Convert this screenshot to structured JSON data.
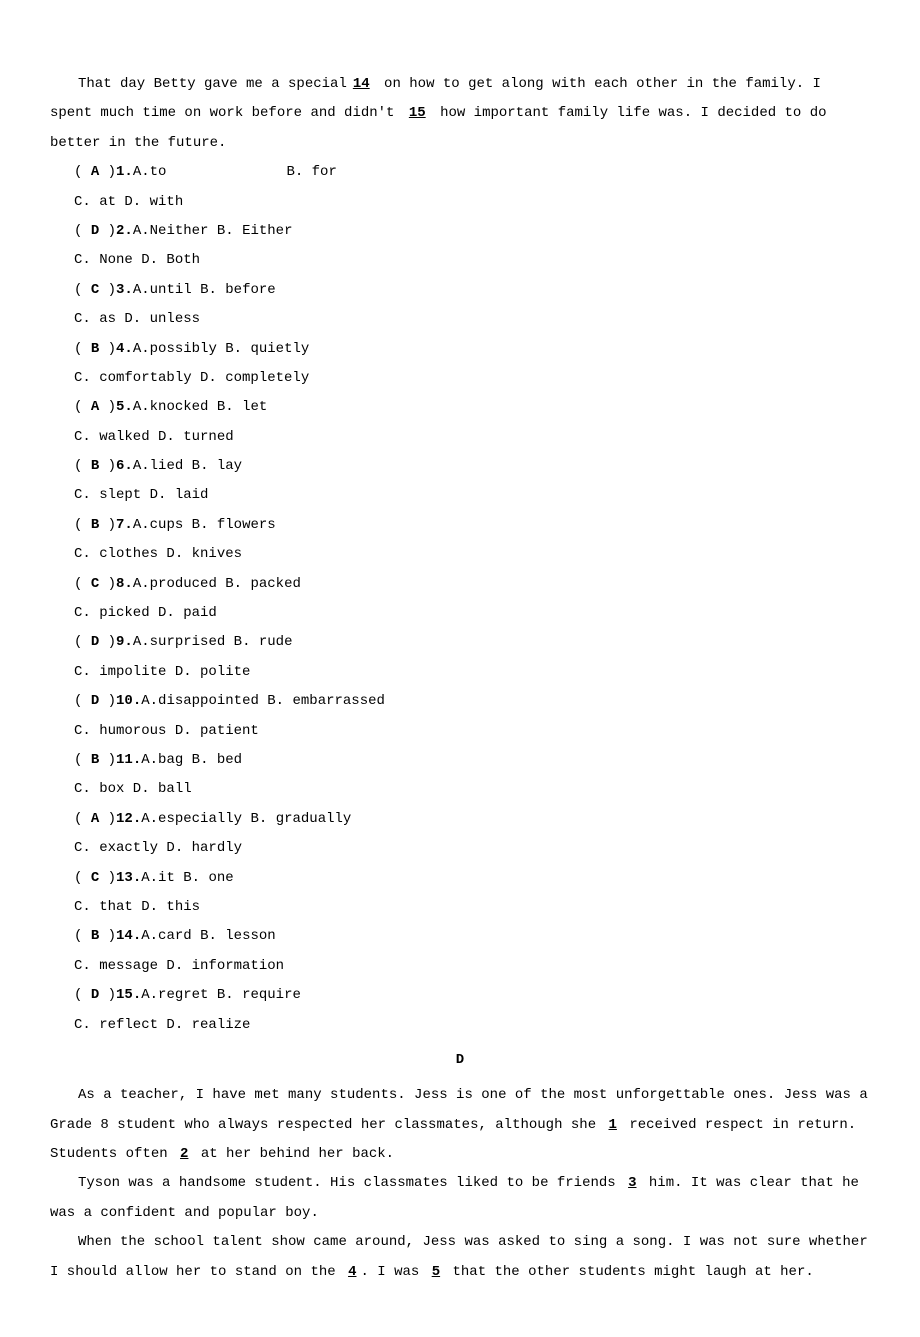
{
  "passage_c": {
    "para1_pre": "That day Betty gave me a special",
    "blank14": "14",
    "para1_mid": " on how to get along with each other in the family. I spent much time on work before and didn't ",
    "blank15": "15",
    "para1_post": " how important family life was. I decided to do better in the future."
  },
  "questions_c": [
    {
      "ans": "A",
      "num": "1",
      "a": "A.to",
      "b_gap": 120,
      "b": "B. for",
      "cd": "C. at  D. with"
    },
    {
      "ans": "D",
      "num": "2",
      "a": "A.Neither",
      "b": "B. Either",
      "cd": "C. None  D. Both"
    },
    {
      "ans": "C",
      "num": "3",
      "a": "A.until",
      "b": "B. before",
      "cd": "C. as  D. unless"
    },
    {
      "ans": "B",
      "num": "4",
      "a": "A.possibly",
      "b": "B. quietly",
      "cd": "C. comfortably  D. completely"
    },
    {
      "ans": "A",
      "num": "5",
      "a": "A.knocked",
      "b": "B. let",
      "cd": "C. walked  D. turned"
    },
    {
      "ans": "B",
      "num": "6",
      "a": "A.lied",
      "b": "B. lay",
      "cd": "C. slept  D. laid"
    },
    {
      "ans": "B",
      "num": "7",
      "a": "A.cups",
      "b": "B. flowers",
      "cd": "C. clothes  D. knives"
    },
    {
      "ans": "C",
      "num": "8",
      "a": "A.produced",
      "b": "B. packed",
      "cd": "C. picked  D. paid"
    },
    {
      "ans": "D",
      "num": "9",
      "a": "A.surprised",
      "b": "B. rude",
      "cd": "C. impolite  D. polite"
    },
    {
      "ans": "D",
      "num": "10",
      "a": "A.disappointed",
      "b": "B. embarrassed",
      "cd": "C. humorous  D. patient"
    },
    {
      "ans": "B",
      "num": "11",
      "a": "A.bag",
      "b": "B. bed",
      "cd": "C. box  D. ball"
    },
    {
      "ans": "A",
      "num": "12",
      "a": "A.especially",
      "b": "B. gradually",
      "cd": "C. exactly  D. hardly"
    },
    {
      "ans": "C",
      "num": "13",
      "a": "A.it",
      "b": "B. one",
      "cd": "C. that  D. this"
    },
    {
      "ans": "B",
      "num": "14",
      "a": "A.card",
      "b": "B. lesson",
      "cd": "C. message  D. information"
    },
    {
      "ans": "D",
      "num": "15",
      "a": "A.regret",
      "b": "B. require",
      "cd": "C. reflect  D. realize"
    }
  ],
  "section_d": {
    "header": "D",
    "p1a": "As a teacher, I have met many students. Jess  is one of the most unforgettable ones. Jess was a Grade 8 student who always respected her classmates, although she ",
    "b1": "1",
    "p1b": "received respect in return. Students often ",
    "b2": "2",
    "p1c": "at her behind her back.",
    "p2a": "Tyson was a handsome student. His classmates liked to be friends ",
    "b3": "3",
    "p2b": "him. It was clear  that he was a confident and popular boy.",
    "p3a": "When the school talent show came around, Jess was asked to sing a song. I was not sure whether I should allow her to stand on the ",
    "b4": "4",
    "p3b": ". I was ",
    "b5": "5",
    "p3c": "that the other students might laugh at her."
  }
}
